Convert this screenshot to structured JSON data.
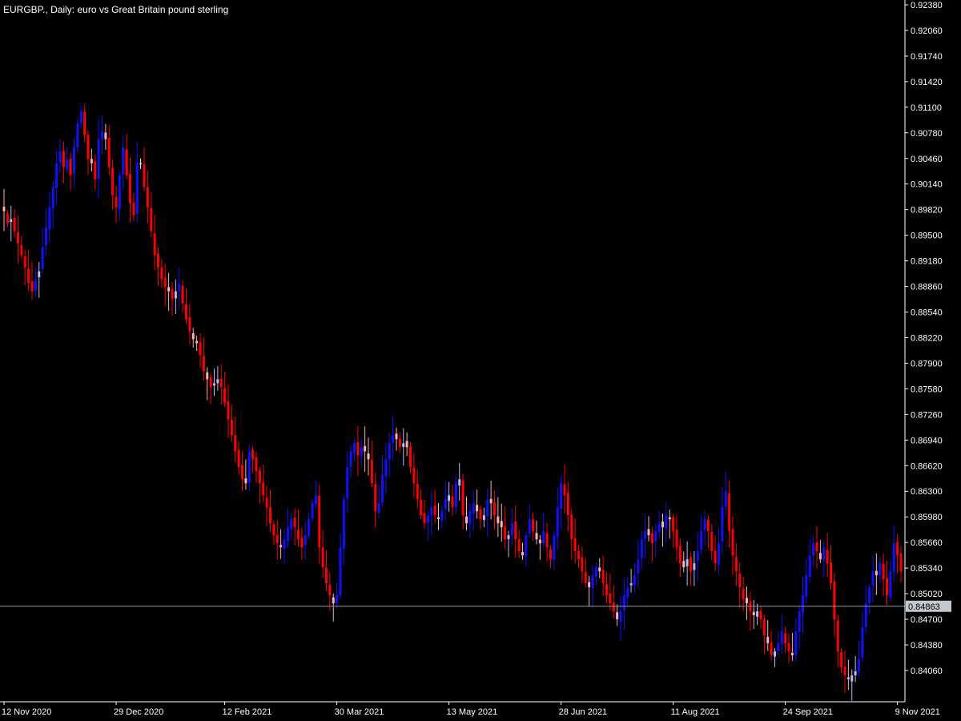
{
  "chart_data": {
    "type": "candlestick",
    "title": "EURGBP., Daily:  euro vs Great Britain pound sterling",
    "symbol": "EURGBP.",
    "timeframe": "Daily",
    "description": "euro vs Great Britain pound sterling",
    "current_price": "0.84863",
    "current_price_value": 0.84863,
    "ylim": [
      0.8383,
      0.9238
    ],
    "y_ticks": [
      "0.92380",
      "0.92060",
      "0.91740",
      "0.91420",
      "0.91100",
      "0.90780",
      "0.90460",
      "0.90140",
      "0.89820",
      "0.89500",
      "0.89180",
      "0.88860",
      "0.88540",
      "0.88220",
      "0.87900",
      "0.87580",
      "0.87260",
      "0.86940",
      "0.86620",
      "0.86300",
      "0.85980",
      "0.85660",
      "0.85340",
      "0.85020",
      "0.84700",
      "0.84380",
      "0.84060"
    ],
    "x_ticks": [
      "12 Nov 2020",
      "29 Dec 2020",
      "12 Feb 2021",
      "30 Mar 2021",
      "13 May 2021",
      "28 Jun 2021",
      "11 Aug 2021",
      "24 Sep 2021",
      "9 Nov 2021"
    ],
    "x_tick_bar_index": [
      0,
      32,
      63,
      95,
      127,
      159,
      191,
      223,
      255
    ],
    "colors": {
      "background": "#000000",
      "text": "#ffffff",
      "axis": "#ffffff",
      "bull_strong": "#1010ff",
      "bull_weak": "#b8b8ff",
      "bear_strong": "#ff0000",
      "bear_weak": "#ffb0b0",
      "neutral": "#ffffff",
      "price_line": "#8a9aa8",
      "price_badge_bg": "#c0c8d0"
    },
    "series_close": [
      0.898,
      0.8965,
      0.897,
      0.8955,
      0.894,
      0.8925,
      0.891,
      0.889,
      0.888,
      0.8895,
      0.8905,
      0.8935,
      0.896,
      0.8985,
      0.901,
      0.904,
      0.9055,
      0.9035,
      0.9045,
      0.9025,
      0.906,
      0.909,
      0.9105,
      0.9075,
      0.9045,
      0.904,
      0.902,
      0.907,
      0.908,
      0.907,
      0.9035,
      0.9,
      0.8985,
      0.9025,
      0.906,
      0.9025,
      0.899,
      0.8975,
      0.904,
      0.904,
      0.901,
      0.8985,
      0.8955,
      0.8925,
      0.891,
      0.8895,
      0.8885,
      0.888,
      0.887,
      0.888,
      0.889,
      0.8865,
      0.8845,
      0.883,
      0.882,
      0.8815,
      0.88,
      0.878,
      0.877,
      0.876,
      0.8765,
      0.877,
      0.876,
      0.874,
      0.872,
      0.87,
      0.868,
      0.866,
      0.8645,
      0.864,
      0.868,
      0.867,
      0.8655,
      0.864,
      0.8625,
      0.861,
      0.859,
      0.8575,
      0.8565,
      0.856,
      0.857,
      0.8585,
      0.8595,
      0.8585,
      0.857,
      0.856,
      0.8575,
      0.8595,
      0.8615,
      0.8625,
      0.856,
      0.8535,
      0.8515,
      0.85,
      0.849,
      0.85,
      0.856,
      0.862,
      0.866,
      0.868,
      0.869,
      0.8675,
      0.8685,
      0.868,
      0.867,
      0.864,
      0.8605,
      0.8615,
      0.865,
      0.867,
      0.869,
      0.87,
      0.8695,
      0.8685,
      0.869,
      0.8685,
      0.866,
      0.864,
      0.862,
      0.86,
      0.859,
      0.86,
      0.861,
      0.86,
      0.8595,
      0.8605,
      0.862,
      0.8625,
      0.861,
      0.864,
      0.8645,
      0.86,
      0.859,
      0.8605,
      0.8615,
      0.8605,
      0.8595,
      0.86,
      0.862,
      0.8615,
      0.86,
      0.859,
      0.8585,
      0.857,
      0.8575,
      0.859,
      0.857,
      0.8555,
      0.855,
      0.8575,
      0.8595,
      0.858,
      0.857,
      0.8565,
      0.858,
      0.856,
      0.8545,
      0.8575,
      0.861,
      0.864,
      0.8625,
      0.86,
      0.857,
      0.8555,
      0.8545,
      0.853,
      0.8515,
      0.851,
      0.8525,
      0.8535,
      0.853,
      0.8515,
      0.85,
      0.849,
      0.848,
      0.847,
      0.848,
      0.85,
      0.851,
      0.8515,
      0.8525,
      0.8545,
      0.857,
      0.858,
      0.8575,
      0.8565,
      0.858,
      0.859,
      0.8585,
      0.86,
      0.8595,
      0.858,
      0.856,
      0.854,
      0.8535,
      0.8545,
      0.853,
      0.854,
      0.8555,
      0.858,
      0.8595,
      0.858,
      0.8555,
      0.854,
      0.8565,
      0.861,
      0.863,
      0.858,
      0.855,
      0.853,
      0.851,
      0.8495,
      0.849,
      0.848,
      0.8475,
      0.848,
      0.847,
      0.845,
      0.844,
      0.8425,
      0.843,
      0.844,
      0.8455,
      0.844,
      0.843,
      0.8425,
      0.8455,
      0.848,
      0.85,
      0.8525,
      0.855,
      0.8565,
      0.8555,
      0.8545,
      0.856,
      0.854,
      0.8515,
      0.847,
      0.843,
      0.841,
      0.84,
      0.8395,
      0.84,
      0.8405,
      0.842,
      0.846,
      0.849,
      0.851,
      0.853,
      0.8525,
      0.854,
      0.852,
      0.85,
      0.853,
      0.8565,
      0.855,
      0.853
    ]
  }
}
